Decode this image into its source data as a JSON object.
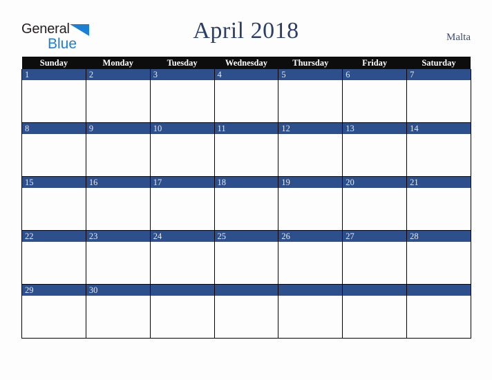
{
  "logo": {
    "word_one": "General",
    "word_two": "Blue",
    "triangle_icon": "triangle-icon",
    "accent_color": "#1b7fd4",
    "text_color": "#231f20"
  },
  "header": {
    "title": "April 2018",
    "country": "Malta",
    "title_color": "#2b3f66"
  },
  "calendar": {
    "weekday_headers": [
      "Sunday",
      "Monday",
      "Tuesday",
      "Wednesday",
      "Thursday",
      "Friday",
      "Saturday"
    ],
    "header_bg": "#0d0d0d",
    "date_bar_bg": "#2d4f8b",
    "date_text_color": "#e8eaef",
    "cell_bg": "#fdfdfd",
    "border_color": "#000000",
    "weeks": [
      {
        "days": [
          {
            "date": "1"
          },
          {
            "date": "2"
          },
          {
            "date": "3"
          },
          {
            "date": "4"
          },
          {
            "date": "5"
          },
          {
            "date": "6"
          },
          {
            "date": "7"
          }
        ]
      },
      {
        "days": [
          {
            "date": "8"
          },
          {
            "date": "9"
          },
          {
            "date": "10"
          },
          {
            "date": "11"
          },
          {
            "date": "12"
          },
          {
            "date": "13"
          },
          {
            "date": "14"
          }
        ]
      },
      {
        "days": [
          {
            "date": "15"
          },
          {
            "date": "16"
          },
          {
            "date": "17"
          },
          {
            "date": "18"
          },
          {
            "date": "19"
          },
          {
            "date": "20"
          },
          {
            "date": "21"
          }
        ]
      },
      {
        "days": [
          {
            "date": "22"
          },
          {
            "date": "23"
          },
          {
            "date": "24"
          },
          {
            "date": "25"
          },
          {
            "date": "26"
          },
          {
            "date": "27"
          },
          {
            "date": "28"
          }
        ]
      },
      {
        "days": [
          {
            "date": "29"
          },
          {
            "date": "30"
          },
          {
            "date": ""
          },
          {
            "date": ""
          },
          {
            "date": ""
          },
          {
            "date": ""
          },
          {
            "date": ""
          }
        ]
      }
    ]
  }
}
